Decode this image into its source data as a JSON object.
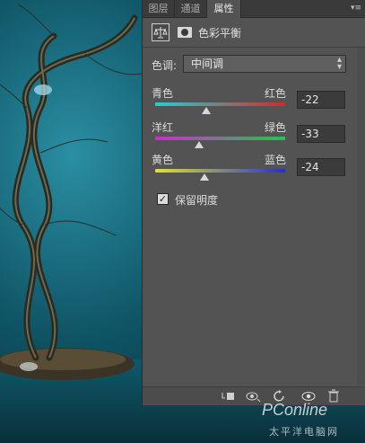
{
  "tabs": [
    {
      "label": "图层"
    },
    {
      "label": "通道"
    },
    {
      "label": "属性"
    }
  ],
  "panel": {
    "menu_glyph": "▾≡",
    "adjustment_title": "色彩平衡",
    "tone": {
      "label": "色调:",
      "value": "中间调"
    },
    "sliders": [
      {
        "left_label": "青色",
        "right_label": "红色",
        "value": "-22",
        "level": -22,
        "left_color": "#21d0d4",
        "right_color": "#d42a2a"
      },
      {
        "left_label": "洋红",
        "right_label": "绿色",
        "value": "-33",
        "level": -33,
        "left_color": "#d02ad0",
        "right_color": "#21c84a"
      },
      {
        "left_label": "黄色",
        "right_label": "蓝色",
        "value": "-24",
        "level": -24,
        "left_color": "#e2e22a",
        "right_color": "#2430d0"
      }
    ],
    "preserve_luminosity": {
      "label": "保留明度",
      "checked": true,
      "mark": "✓"
    }
  },
  "bottom_icons": [
    "clip-to-layer-icon",
    "view-previous-icon",
    "reset-icon",
    "visibility-icon",
    "trash-icon"
  ],
  "watermark": {
    "brand": "PConline",
    "site": "太平洋电脑网"
  }
}
